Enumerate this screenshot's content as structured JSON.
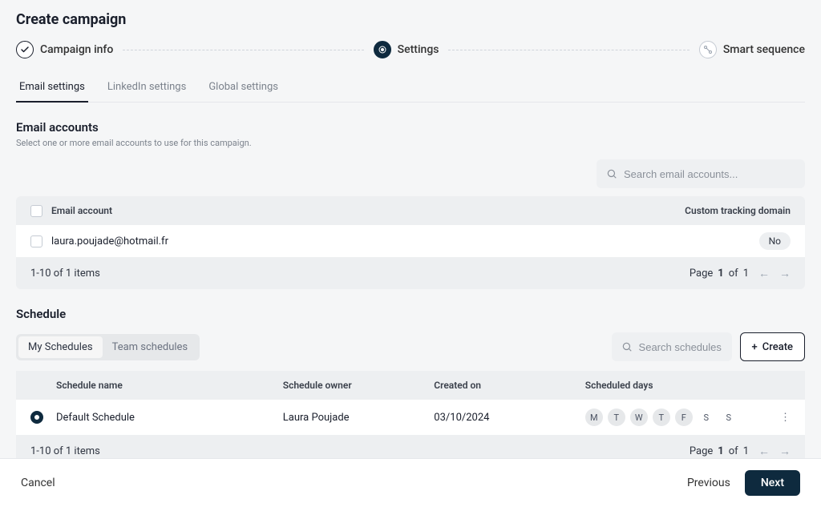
{
  "page_title": "Create campaign",
  "stepper": {
    "steps": [
      {
        "label": "Campaign info"
      },
      {
        "label": "Settings"
      },
      {
        "label": "Smart sequence"
      }
    ]
  },
  "tabs": {
    "items": [
      {
        "label": "Email settings"
      },
      {
        "label": "LinkedIn settings"
      },
      {
        "label": "Global settings"
      }
    ]
  },
  "email_section": {
    "title": "Email accounts",
    "subtitle": "Select one or more email accounts to use for this campaign.",
    "search_placeholder": "Search email accounts...",
    "col_account": "Email account",
    "col_domain": "Custom tracking domain",
    "rows": [
      {
        "email": "laura.poujade@hotmail.fr",
        "domain": "No"
      }
    ],
    "footer_count": "1-10 of 1 items",
    "page_word": "Page",
    "page_current": "1",
    "page_of": "of",
    "page_total": "1"
  },
  "schedule_section": {
    "title": "Schedule",
    "seg_tabs": [
      {
        "label": "My Schedules"
      },
      {
        "label": "Team schedules"
      }
    ],
    "search_placeholder": "Search schedules...",
    "create_label": "Create",
    "cols": {
      "name": "Schedule name",
      "owner": "Schedule owner",
      "created": "Created on",
      "days": "Scheduled days"
    },
    "rows": [
      {
        "name": "Default Schedule",
        "owner": "Laura Poujade",
        "created": "03/10/2024",
        "days": [
          "M",
          "T",
          "W",
          "T",
          "F",
          "S",
          "S"
        ],
        "active_days": [
          true,
          true,
          true,
          true,
          true,
          false,
          false
        ]
      }
    ],
    "footer_count": "1-10 of 1 items",
    "page_word": "Page",
    "page_current": "1",
    "page_of": "of",
    "page_total": "1"
  },
  "footer": {
    "cancel": "Cancel",
    "previous": "Previous",
    "next": "Next"
  }
}
